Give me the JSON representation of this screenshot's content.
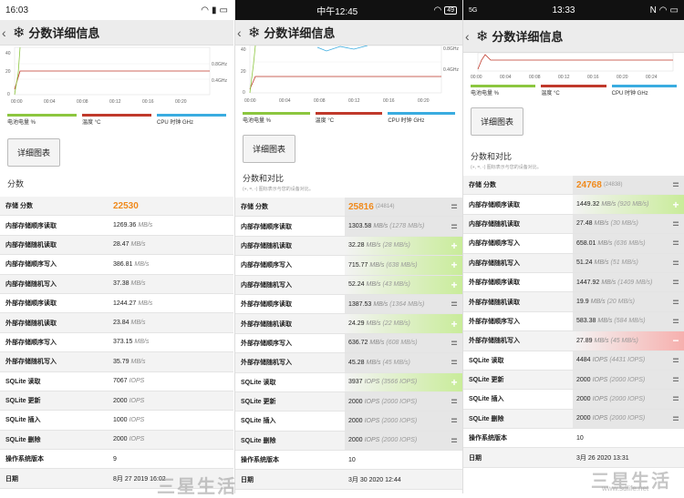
{
  "p1": {
    "status": {
      "time": "16:03"
    },
    "title": "分数详细信息",
    "chart": {
      "y_ticks": [
        "40",
        "20",
        "0"
      ],
      "x_ticks": [
        "00:00",
        "00:04",
        "00:08",
        "00:12",
        "00:16",
        "00:20"
      ],
      "right_ticks": [
        "0.8GHz",
        "0.4GHz"
      ]
    },
    "legend": [
      {
        "label": "电池电量 %",
        "color": "#8cc63f"
      },
      {
        "label": "温度 °C",
        "color": "#c0392b"
      },
      {
        "label": "CPU 时钟 GHz",
        "color": "#3aace0"
      }
    ],
    "button": "详细图表",
    "section": "分数",
    "rows": [
      {
        "label": "存储 分数",
        "value": "22530",
        "unit": "",
        "score": true
      },
      {
        "label": "内部存储顺序读取",
        "value": "1269.36",
        "unit": "MB/s"
      },
      {
        "label": "内部存储随机读取",
        "value": "28.47",
        "unit": "MB/s"
      },
      {
        "label": "内部存储顺序写入",
        "value": "386.81",
        "unit": "MB/s"
      },
      {
        "label": "内部存储随机写入",
        "value": "37.38",
        "unit": "MB/s"
      },
      {
        "label": "外部存储顺序读取",
        "value": "1244.27",
        "unit": "MB/s"
      },
      {
        "label": "外部存储随机读取",
        "value": "23.84",
        "unit": "MB/s"
      },
      {
        "label": "外部存储顺序写入",
        "value": "373.15",
        "unit": "MB/s"
      },
      {
        "label": "外部存储随机写入",
        "value": "35.79",
        "unit": "MB/s"
      },
      {
        "label": "SQLite 读取",
        "value": "7067",
        "unit": "IOPS"
      },
      {
        "label": "SQLite 更新",
        "value": "2000",
        "unit": "IOPS"
      },
      {
        "label": "SQLite 插入",
        "value": "1000",
        "unit": "IOPS"
      },
      {
        "label": "SQLite 删除",
        "value": "2000",
        "unit": "IOPS"
      },
      {
        "label": "操作系统版本",
        "value": "9",
        "unit": ""
      },
      {
        "label": "日期",
        "value": "8月 27 2019 16:02",
        "unit": ""
      }
    ]
  },
  "p2": {
    "status": {
      "time": "中午12:45",
      "battery": "49"
    },
    "title": "分数详细信息",
    "chart": {
      "y_ticks": [
        "40",
        "20",
        "0"
      ],
      "x_ticks": [
        "00:00",
        "00:04",
        "00:08",
        "00:12",
        "00:16",
        "00:20"
      ],
      "right_ticks": [
        "0.8GHz",
        "0.4GHz"
      ]
    },
    "legend": [
      {
        "label": "电池电量 %",
        "color": "#8cc63f"
      },
      {
        "label": "温度 °C",
        "color": "#c0392b"
      },
      {
        "label": "CPU 时钟 GHz",
        "color": "#3aace0"
      }
    ],
    "button": "详细图表",
    "section": "分数和对比",
    "hint": "(+, =, -) 图标表示与您的设备对比。",
    "rows": [
      {
        "label": "存储 分数",
        "value": "25816",
        "ref": "(24814)",
        "score": true,
        "state": "n",
        "icon": "="
      },
      {
        "label": "内部存储顺序读取",
        "value": "1303.58",
        "unit": "MB/s",
        "ref": "(1278 MB/s)",
        "state": "n",
        "icon": "="
      },
      {
        "label": "内部存储随机读取",
        "value": "32.28",
        "unit": "MB/s",
        "ref": "(28 MB/s)",
        "state": "g",
        "icon": "+"
      },
      {
        "label": "内部存储顺序写入",
        "value": "715.77",
        "unit": "MB/s",
        "ref": "(638 MB/s)",
        "state": "g",
        "icon": "+"
      },
      {
        "label": "内部存储随机写入",
        "value": "52.24",
        "unit": "MB/s",
        "ref": "(43 MB/s)",
        "state": "g",
        "icon": "+"
      },
      {
        "label": "外部存储顺序读取",
        "value": "1387.53",
        "unit": "MB/s",
        "ref": "(1364 MB/s)",
        "state": "n",
        "icon": "="
      },
      {
        "label": "外部存储随机读取",
        "value": "24.29",
        "unit": "MB/s",
        "ref": "(22 MB/s)",
        "state": "g",
        "icon": "+"
      },
      {
        "label": "外部存储顺序写入",
        "value": "636.72",
        "unit": "MB/s",
        "ref": "(608 MB/s)",
        "state": "n",
        "icon": "="
      },
      {
        "label": "外部存储随机写入",
        "value": "45.28",
        "unit": "MB/s",
        "ref": "(45 MB/s)",
        "state": "n",
        "icon": "="
      },
      {
        "label": "SQLite 读取",
        "value": "3937",
        "unit": "IOPS",
        "ref": "(3566 IOPS)",
        "state": "g",
        "icon": "+"
      },
      {
        "label": "SQLite 更新",
        "value": "2000",
        "unit": "IOPS",
        "ref": "(2000 IOPS)",
        "state": "n",
        "icon": "="
      },
      {
        "label": "SQLite 插入",
        "value": "2000",
        "unit": "IOPS",
        "ref": "(2000 IOPS)",
        "state": "n",
        "icon": "="
      },
      {
        "label": "SQLite 删除",
        "value": "2000",
        "unit": "IOPS",
        "ref": "(2000 IOPS)",
        "state": "n",
        "icon": "="
      },
      {
        "label": "操作系统版本",
        "value": "10",
        "unit": "",
        "ref": "",
        "state": "none"
      },
      {
        "label": "日期",
        "value": "3月 30 2020 12:44",
        "unit": "",
        "ref": "",
        "state": "none"
      }
    ]
  },
  "p3": {
    "status": {
      "time": "13:33"
    },
    "title": "分数详细信息",
    "chart": {
      "x_ticks": [
        "00:00",
        "00:04",
        "00:08",
        "00:12",
        "00:16",
        "00:20",
        "00:24"
      ]
    },
    "legend": [
      {
        "label": "电池电量 %",
        "color": "#8cc63f"
      },
      {
        "label": "温度 °C",
        "color": "#c0392b"
      },
      {
        "label": "CPU 时钟 GHz",
        "color": "#3aace0"
      }
    ],
    "button": "详细图表",
    "section": "分数和对比",
    "hint": "(+, =, -) 图标表示与您的设备对比。",
    "rows": [
      {
        "label": "存储 分数",
        "value": "24768",
        "ref": "(24838)",
        "score": true,
        "state": "n",
        "icon": "="
      },
      {
        "label": "内部存储顺序读取",
        "value": "1449.32",
        "unit": "MB/s",
        "ref": "(920 MB/s)",
        "state": "g",
        "icon": "+"
      },
      {
        "label": "内部存储随机读取",
        "value": "27.48",
        "unit": "MB/s",
        "ref": "(30 MB/s)",
        "state": "n",
        "icon": "="
      },
      {
        "label": "内部存储顺序写入",
        "value": "658.01",
        "unit": "MB/s",
        "ref": "(636 MB/s)",
        "state": "n",
        "icon": "="
      },
      {
        "label": "内部存储随机写入",
        "value": "51.24",
        "unit": "MB/s",
        "ref": "(51 MB/s)",
        "state": "n",
        "icon": "="
      },
      {
        "label": "外部存储顺序读取",
        "value": "1447.92",
        "unit": "MB/s",
        "ref": "(1409 MB/s)",
        "state": "n",
        "icon": "="
      },
      {
        "label": "外部存储随机读取",
        "value": "19.9",
        "unit": "MB/s",
        "ref": "(20 MB/s)",
        "state": "n",
        "icon": "="
      },
      {
        "label": "外部存储顺序写入",
        "value": "583.38",
        "unit": "MB/s",
        "ref": "(584 MB/s)",
        "state": "n",
        "icon": "="
      },
      {
        "label": "外部存储随机写入",
        "value": "27.89",
        "unit": "MB/s",
        "ref": "(45 MB/s)",
        "state": "r",
        "icon": "−"
      },
      {
        "label": "SQLite 读取",
        "value": "4484",
        "unit": "IOPS",
        "ref": "(4431 IOPS)",
        "state": "n",
        "icon": "="
      },
      {
        "label": "SQLite 更新",
        "value": "2000",
        "unit": "IOPS",
        "ref": "(2000 IOPS)",
        "state": "n",
        "icon": "="
      },
      {
        "label": "SQLite 插入",
        "value": "2000",
        "unit": "IOPS",
        "ref": "(2000 IOPS)",
        "state": "n",
        "icon": "="
      },
      {
        "label": "SQLite 删除",
        "value": "2000",
        "unit": "IOPS",
        "ref": "(2000 IOPS)",
        "state": "n",
        "icon": "="
      },
      {
        "label": "操作系统版本",
        "value": "10",
        "unit": "",
        "ref": "",
        "state": "none"
      },
      {
        "label": "日期",
        "value": "3月 26 2020 13:31",
        "unit": "",
        "ref": "",
        "state": "none"
      }
    ]
  },
  "watermark": {
    "text": "三星生活",
    "url": "www.sdlife.net"
  }
}
